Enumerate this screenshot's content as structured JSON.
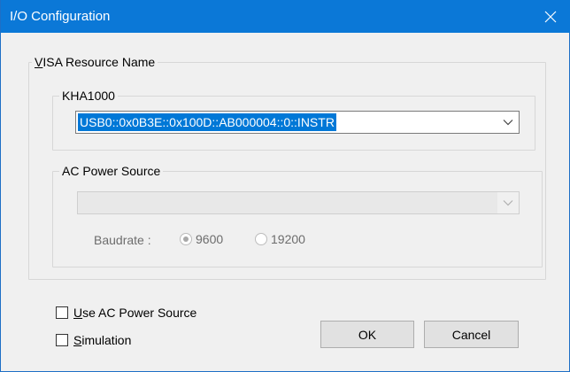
{
  "window": {
    "title": "I/O Configuration"
  },
  "visa_group": {
    "label_prefix": "",
    "label_access": "V",
    "label_rest": "ISA Resource Name"
  },
  "kha_group": {
    "label": "KHA1000",
    "selected_value": "USB0::0x0B3E::0x100D::AB000004::0::INSTR"
  },
  "ac_group": {
    "label": "AC Power Source",
    "selected_value": "",
    "baudrate_label": "Baudrate :",
    "baud_options": [
      {
        "label": "9600",
        "selected": true
      },
      {
        "label": "19200",
        "selected": false
      }
    ]
  },
  "options": {
    "use_ac": {
      "access": "U",
      "rest": "se AC Power Source",
      "checked": false
    },
    "simulation": {
      "access": "S",
      "rest": "imulation",
      "checked": false
    }
  },
  "buttons": {
    "ok": "OK",
    "cancel": "Cancel"
  },
  "colors": {
    "titlebar": "#0b78d7",
    "selection": "#0078d7",
    "dialog_bg": "#f0f0f0"
  },
  "icons": {
    "close": "close-icon",
    "dropdown": "chevron-down-icon"
  }
}
